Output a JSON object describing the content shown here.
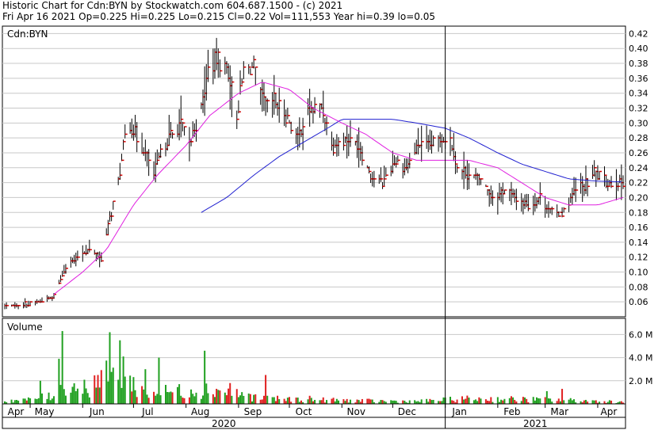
{
  "header": {
    "line1": "Historic Chart for Cdn:BYN by Stockwatch.com 604.687.1500 - (c) 2021",
    "line2": "Fri Apr 16 2021  Op=0.225  Hi=0.225  Lo=0.215  Cl=0.22  Vol=111,553  Year hi=0.39  lo=0.05"
  },
  "colors": {
    "ma_short": "#e020e0",
    "ma_long": "#2020d0",
    "up_volume": "#20a020",
    "down_volume": "#e02020",
    "close_tick": "#d00000",
    "grid": "#c8c8c8"
  },
  "chart_data": [
    {
      "type": "line",
      "subtype": "ohlc_with_moving_averages",
      "symbol_label": "Cdn:BYN",
      "x_tick_labels": [
        "Apr",
        "May",
        "Jun",
        "Jul",
        "Aug",
        "Sep",
        "Oct",
        "Nov",
        "Dec",
        "Jan",
        "Feb",
        "Mar",
        "Apr"
      ],
      "year_labels": [
        "2020",
        "2021"
      ],
      "y_ticks": [
        "0.42",
        "0.40",
        "0.38",
        "0.36",
        "0.34",
        "0.32",
        "0.30",
        "0.28",
        "0.26",
        "0.24",
        "0.22",
        "0.20",
        "0.18",
        "0.16",
        "0.14",
        "0.12",
        "0.10",
        "0.08",
        "0.06"
      ],
      "ylim": [
        0.04,
        0.43
      ],
      "grid": true,
      "price_anchors": [
        [
          "2020-04-16",
          0.055
        ],
        [
          "2020-04-25",
          0.055
        ],
        [
          "2020-05-05",
          0.06
        ],
        [
          "2020-05-15",
          0.067
        ],
        [
          "2020-05-22",
          0.11
        ],
        [
          "2020-05-29",
          0.12
        ],
        [
          "2020-06-05",
          0.13
        ],
        [
          "2020-06-12",
          0.12
        ],
        [
          "2020-06-16",
          0.16
        ],
        [
          "2020-06-22",
          0.22
        ],
        [
          "2020-06-26",
          0.28
        ],
        [
          "2020-06-29",
          0.3
        ],
        [
          "2020-07-03",
          0.28
        ],
        [
          "2020-07-08",
          0.26
        ],
        [
          "2020-07-13",
          0.23
        ],
        [
          "2020-07-17",
          0.26
        ],
        [
          "2020-07-22",
          0.28
        ],
        [
          "2020-07-29",
          0.3
        ],
        [
          "2020-08-03",
          0.27
        ],
        [
          "2020-08-10",
          0.32
        ],
        [
          "2020-08-14",
          0.37
        ],
        [
          "2020-08-19",
          0.385
        ],
        [
          "2020-08-26",
          0.37
        ],
        [
          "2020-08-31",
          0.31
        ],
        [
          "2020-09-04",
          0.37
        ],
        [
          "2020-09-10",
          0.375
        ],
        [
          "2020-09-15",
          0.33
        ],
        [
          "2020-09-18",
          0.32
        ],
        [
          "2020-09-22",
          0.33
        ],
        [
          "2020-09-29",
          0.31
        ],
        [
          "2020-10-06",
          0.28
        ],
        [
          "2020-10-13",
          0.32
        ],
        [
          "2020-10-20",
          0.32
        ],
        [
          "2020-10-27",
          0.27
        ],
        [
          "2020-11-04",
          0.28
        ],
        [
          "2020-11-11",
          0.27
        ],
        [
          "2020-11-18",
          0.23
        ],
        [
          "2020-11-25",
          0.22
        ],
        [
          "2020-12-02",
          0.25
        ],
        [
          "2020-12-09",
          0.24
        ],
        [
          "2020-12-16",
          0.27
        ],
        [
          "2020-12-23",
          0.27
        ],
        [
          "2020-12-30",
          0.28
        ],
        [
          "2021-01-04",
          0.28
        ],
        [
          "2021-01-08",
          0.24
        ],
        [
          "2021-01-15",
          0.23
        ],
        [
          "2021-01-22",
          0.225
        ],
        [
          "2021-01-29",
          0.2
        ],
        [
          "2021-02-05",
          0.21
        ],
        [
          "2021-02-12",
          0.2
        ],
        [
          "2021-02-19",
          0.19
        ],
        [
          "2021-02-26",
          0.2
        ],
        [
          "2021-03-05",
          0.18
        ],
        [
          "2021-03-12",
          0.18
        ],
        [
          "2021-03-19",
          0.21
        ],
        [
          "2021-03-26",
          0.22
        ],
        [
          "2021-03-30",
          0.235
        ],
        [
          "2021-04-06",
          0.22
        ],
        [
          "2021-04-16",
          0.22
        ]
      ],
      "moving_average_short": [
        [
          "2020-05-15",
          0.07
        ],
        [
          "2020-06-01",
          0.1
        ],
        [
          "2020-06-15",
          0.13
        ],
        [
          "2020-07-01",
          0.19
        ],
        [
          "2020-07-15",
          0.23
        ],
        [
          "2020-08-01",
          0.27
        ],
        [
          "2020-08-15",
          0.31
        ],
        [
          "2020-09-01",
          0.34
        ],
        [
          "2020-09-15",
          0.355
        ],
        [
          "2020-10-01",
          0.345
        ],
        [
          "2020-10-15",
          0.32
        ],
        [
          "2020-11-01",
          0.3
        ],
        [
          "2020-11-15",
          0.285
        ],
        [
          "2020-12-01",
          0.26
        ],
        [
          "2020-12-15",
          0.25
        ],
        [
          "2021-01-01",
          0.25
        ],
        [
          "2021-01-15",
          0.25
        ],
        [
          "2021-02-01",
          0.24
        ],
        [
          "2021-02-15",
          0.22
        ],
        [
          "2021-03-01",
          0.2
        ],
        [
          "2021-03-15",
          0.19
        ],
        [
          "2021-04-01",
          0.19
        ],
        [
          "2021-04-16",
          0.2
        ]
      ],
      "moving_average_long": [
        [
          "2020-08-10",
          0.18
        ],
        [
          "2020-08-25",
          0.2
        ],
        [
          "2020-09-10",
          0.23
        ],
        [
          "2020-09-25",
          0.255
        ],
        [
          "2020-10-10",
          0.275
        ],
        [
          "2020-10-25",
          0.295
        ],
        [
          "2020-11-01",
          0.305
        ],
        [
          "2020-11-15",
          0.305
        ],
        [
          "2020-12-01",
          0.305
        ],
        [
          "2020-12-15",
          0.3
        ],
        [
          "2021-01-01",
          0.293
        ],
        [
          "2021-01-15",
          0.28
        ],
        [
          "2021-02-01",
          0.26
        ],
        [
          "2021-02-15",
          0.245
        ],
        [
          "2021-03-01",
          0.235
        ],
        [
          "2021-03-15",
          0.225
        ],
        [
          "2021-04-01",
          0.222
        ],
        [
          "2021-04-16",
          0.221
        ]
      ]
    },
    {
      "type": "bar",
      "title": "Volume",
      "y_ticks": [
        "6.0 M",
        "4.0 M",
        "2.0 M"
      ],
      "ylim": [
        0,
        7400000
      ],
      "grid": true,
      "volume_anchors": [
        [
          "2020-04-16",
          300000
        ],
        [
          "2020-05-01",
          400000
        ],
        [
          "2020-05-15",
          800000
        ],
        [
          "2020-05-20",
          2000000
        ],
        [
          "2020-06-01",
          1500000
        ],
        [
          "2020-06-15",
          2500000
        ],
        [
          "2020-06-25",
          2400000
        ],
        [
          "2020-07-10",
          1000000
        ],
        [
          "2020-08-15",
          1500000
        ],
        [
          "2020-09-15",
          500000
        ],
        [
          "2020-10-15",
          400000
        ],
        [
          "2020-11-15",
          300000
        ],
        [
          "2020-12-15",
          250000
        ],
        [
          "2021-01-15",
          500000
        ],
        [
          "2021-02-15",
          450000
        ],
        [
          "2021-03-15",
          350000
        ],
        [
          "2021-04-16",
          200000
        ]
      ],
      "volume_spikes": [
        [
          "2020-05-20",
          6300000
        ],
        [
          "2020-06-17",
          6200000
        ],
        [
          "2020-06-23",
          5500000
        ],
        [
          "2020-05-18",
          3900000
        ],
        [
          "2020-06-25",
          4100000
        ],
        [
          "2020-07-16",
          4000000
        ],
        [
          "2020-08-12",
          4600000
        ],
        [
          "2020-05-07",
          2000000
        ],
        [
          "2020-06-10",
          2500000
        ],
        [
          "2020-07-08",
          3000000
        ],
        [
          "2020-08-27",
          1800000
        ],
        [
          "2020-09-17",
          2500000
        ],
        [
          "2020-10-13",
          700000
        ],
        [
          "2021-03-02",
          1100000
        ],
        [
          "2021-03-11",
          1300000
        ]
      ]
    }
  ]
}
